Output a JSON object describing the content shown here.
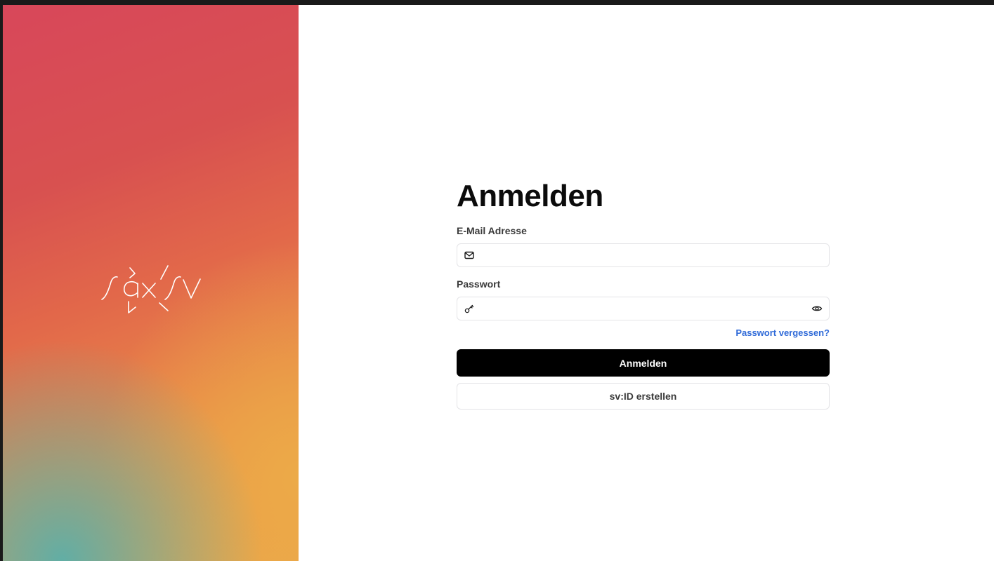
{
  "brand": {
    "logo_text": "saxsv",
    "gradient_colors": [
      "#d8475a",
      "#e2684a",
      "#eaa54a",
      "#5aafaa"
    ]
  },
  "login": {
    "title": "Anmelden",
    "email": {
      "label": "E-Mail Adresse",
      "value": "",
      "icon": "mail-icon"
    },
    "password": {
      "label": "Passwort",
      "value": "",
      "icon": "key-icon",
      "toggle_icon": "eye-icon"
    },
    "forgot_link": "Passwort vergessen?",
    "submit_label": "Anmelden",
    "create_label": "sv:ID erstellen"
  },
  "colors": {
    "link": "#2f6ad8",
    "primary_button": "#000000",
    "border": "#e4e4e7"
  }
}
